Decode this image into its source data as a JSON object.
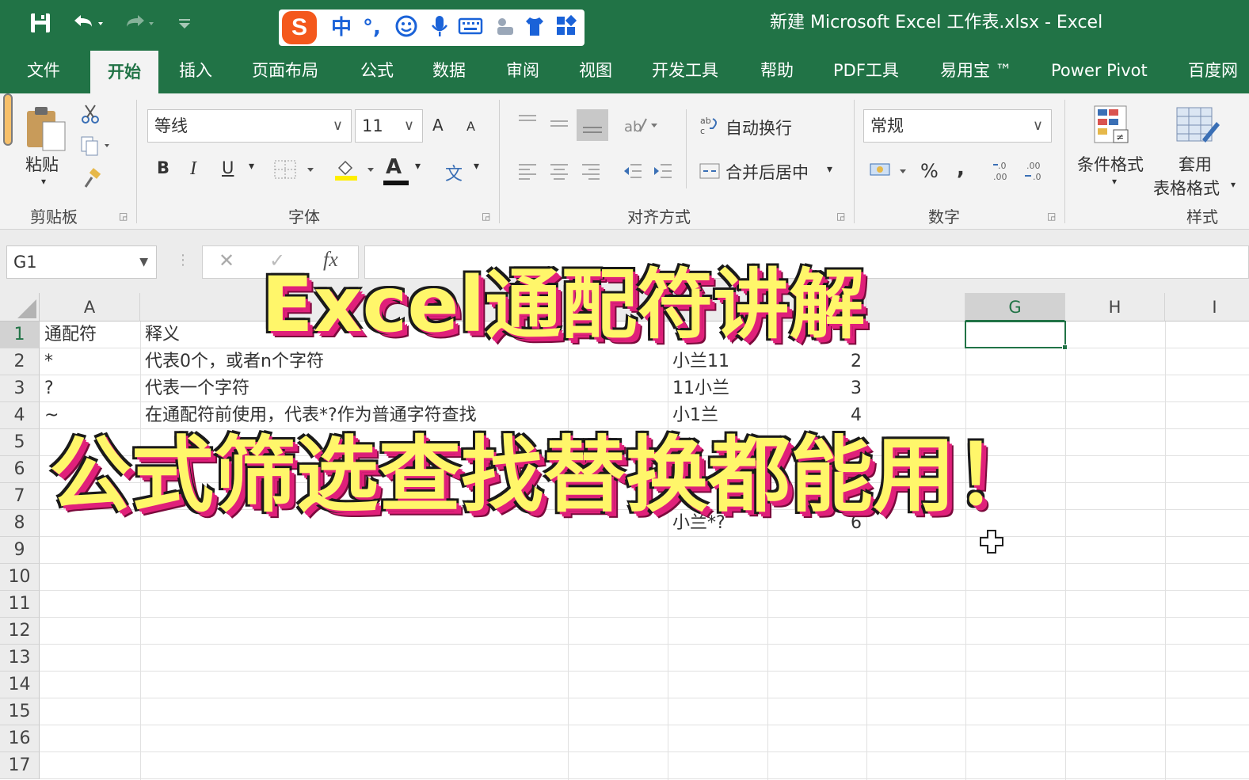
{
  "window": {
    "doc_title": "新建 Microsoft Excel 工作表.xlsx  -  Excel",
    "accent_color": "#217346"
  },
  "quick_access": {
    "save_icon": "save-icon",
    "undo_icon": "undo-icon",
    "redo_icon": "redo-icon",
    "customize_icon": "customize-qat-icon"
  },
  "ime_toolbar": {
    "logo": "S",
    "mode": "中",
    "punct": "°,",
    "emoji_icon": "emoji-icon",
    "voice_icon": "microphone-icon",
    "keyboard_icon": "keyboard-icon",
    "tools_icon": "tools-icon",
    "skin_icon": "shirt-icon",
    "grid_icon": "apps-grid-icon"
  },
  "tabs": [
    "文件",
    "开始",
    "插入",
    "页面布局",
    "公式",
    "数据",
    "审阅",
    "视图",
    "开发工具",
    "帮助",
    "PDF工具",
    "易用宝 ™",
    "Power Pivot",
    "百度网"
  ],
  "active_tab": "开始",
  "ribbon": {
    "clipboard": {
      "label": "剪贴板",
      "paste": "粘贴"
    },
    "font": {
      "label": "字体",
      "font_name": "等线",
      "font_size": "11",
      "bold": "B",
      "italic": "I",
      "underline": "U",
      "grow": "A",
      "shrink": "A",
      "font_color_letter": "A",
      "phonetic": "文"
    },
    "alignment": {
      "label": "对齐方式",
      "wrap_text": "自动换行",
      "merge_center": "合并后居中"
    },
    "number": {
      "label": "数字",
      "format": "常规",
      "percent": "%",
      "comma": ","
    },
    "styles": {
      "label": "样式",
      "conditional": "条件格式",
      "table_format_1": "套用",
      "table_format_2": "表格格式"
    }
  },
  "formula_bar": {
    "name_box": "G1",
    "cancel": "✕",
    "confirm": "✓",
    "fx": "fx",
    "value": ""
  },
  "grid": {
    "columns": [
      "A",
      "G",
      "H",
      "I"
    ],
    "selected_column": "G",
    "rows": [
      "1",
      "2",
      "3",
      "4",
      "5",
      "6",
      "7",
      "8",
      "9",
      "10",
      "11",
      "12",
      "13",
      "14",
      "15",
      "16",
      "17"
    ],
    "col_a": [
      "通配符",
      "*",
      "?",
      "~"
    ],
    "col_b": [
      "释义",
      "代表0个，或者n个字符",
      "代表一个字符",
      "在通配符前使用，代表*?作为普通字符查找"
    ],
    "col_d": [
      "小兰11",
      "11小兰",
      "小1兰",
      "小兰*?"
    ],
    "col_e": [
      "2",
      "3",
      "4",
      "6"
    ]
  },
  "overlay": {
    "title": "Excel通配符讲解",
    "subtitle": "公式筛选查找替换都能用！"
  }
}
